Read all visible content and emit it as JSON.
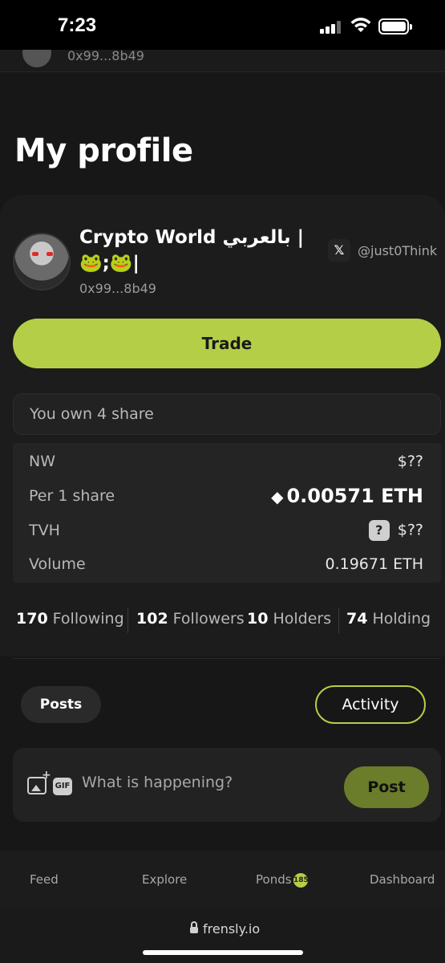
{
  "status_bar": {
    "time": "7:23"
  },
  "top_strip": {
    "address": "0x99...8b49"
  },
  "page": {
    "title": "My profile"
  },
  "profile": {
    "name": "Crypto World بالعربي | 🐸;🐸|",
    "address": "0x99...8b49",
    "x_icon_glyph": "𝕏",
    "x_handle": "@just0Think"
  },
  "trade_button": {
    "label": "Trade"
  },
  "ownership": {
    "text": "You own 4 share"
  },
  "stats": {
    "nw": {
      "label": "NW",
      "value": "$??"
    },
    "per_share": {
      "label": "Per 1 share",
      "value": "0.00571 ETH",
      "icon": "◆"
    },
    "tvh": {
      "label": "TVH",
      "value": "$??",
      "help_glyph": "?"
    },
    "volume": {
      "label": "Volume",
      "value": "0.19671 ETH"
    }
  },
  "counts": {
    "following": {
      "count": "170",
      "label": "Following"
    },
    "followers": {
      "count": "102",
      "label": "Followers"
    },
    "holders": {
      "count": "10",
      "label": "Holders"
    },
    "holding": {
      "count": "74",
      "label": "Holding"
    }
  },
  "tabs": {
    "posts": "Posts",
    "activity": "Activity"
  },
  "composer": {
    "placeholder": "What is happening?",
    "gif_label": "GIF",
    "post_label": "Post"
  },
  "bottom_nav": {
    "feed": "Feed",
    "explore": "Explore",
    "ponds": "Ponds",
    "ponds_badge": "185",
    "dashboard": "Dashboard"
  },
  "browser": {
    "url": "frensly.io"
  },
  "colors": {
    "accent": "#b4cf47",
    "background": "#171717",
    "card": "#1c1c1c"
  }
}
